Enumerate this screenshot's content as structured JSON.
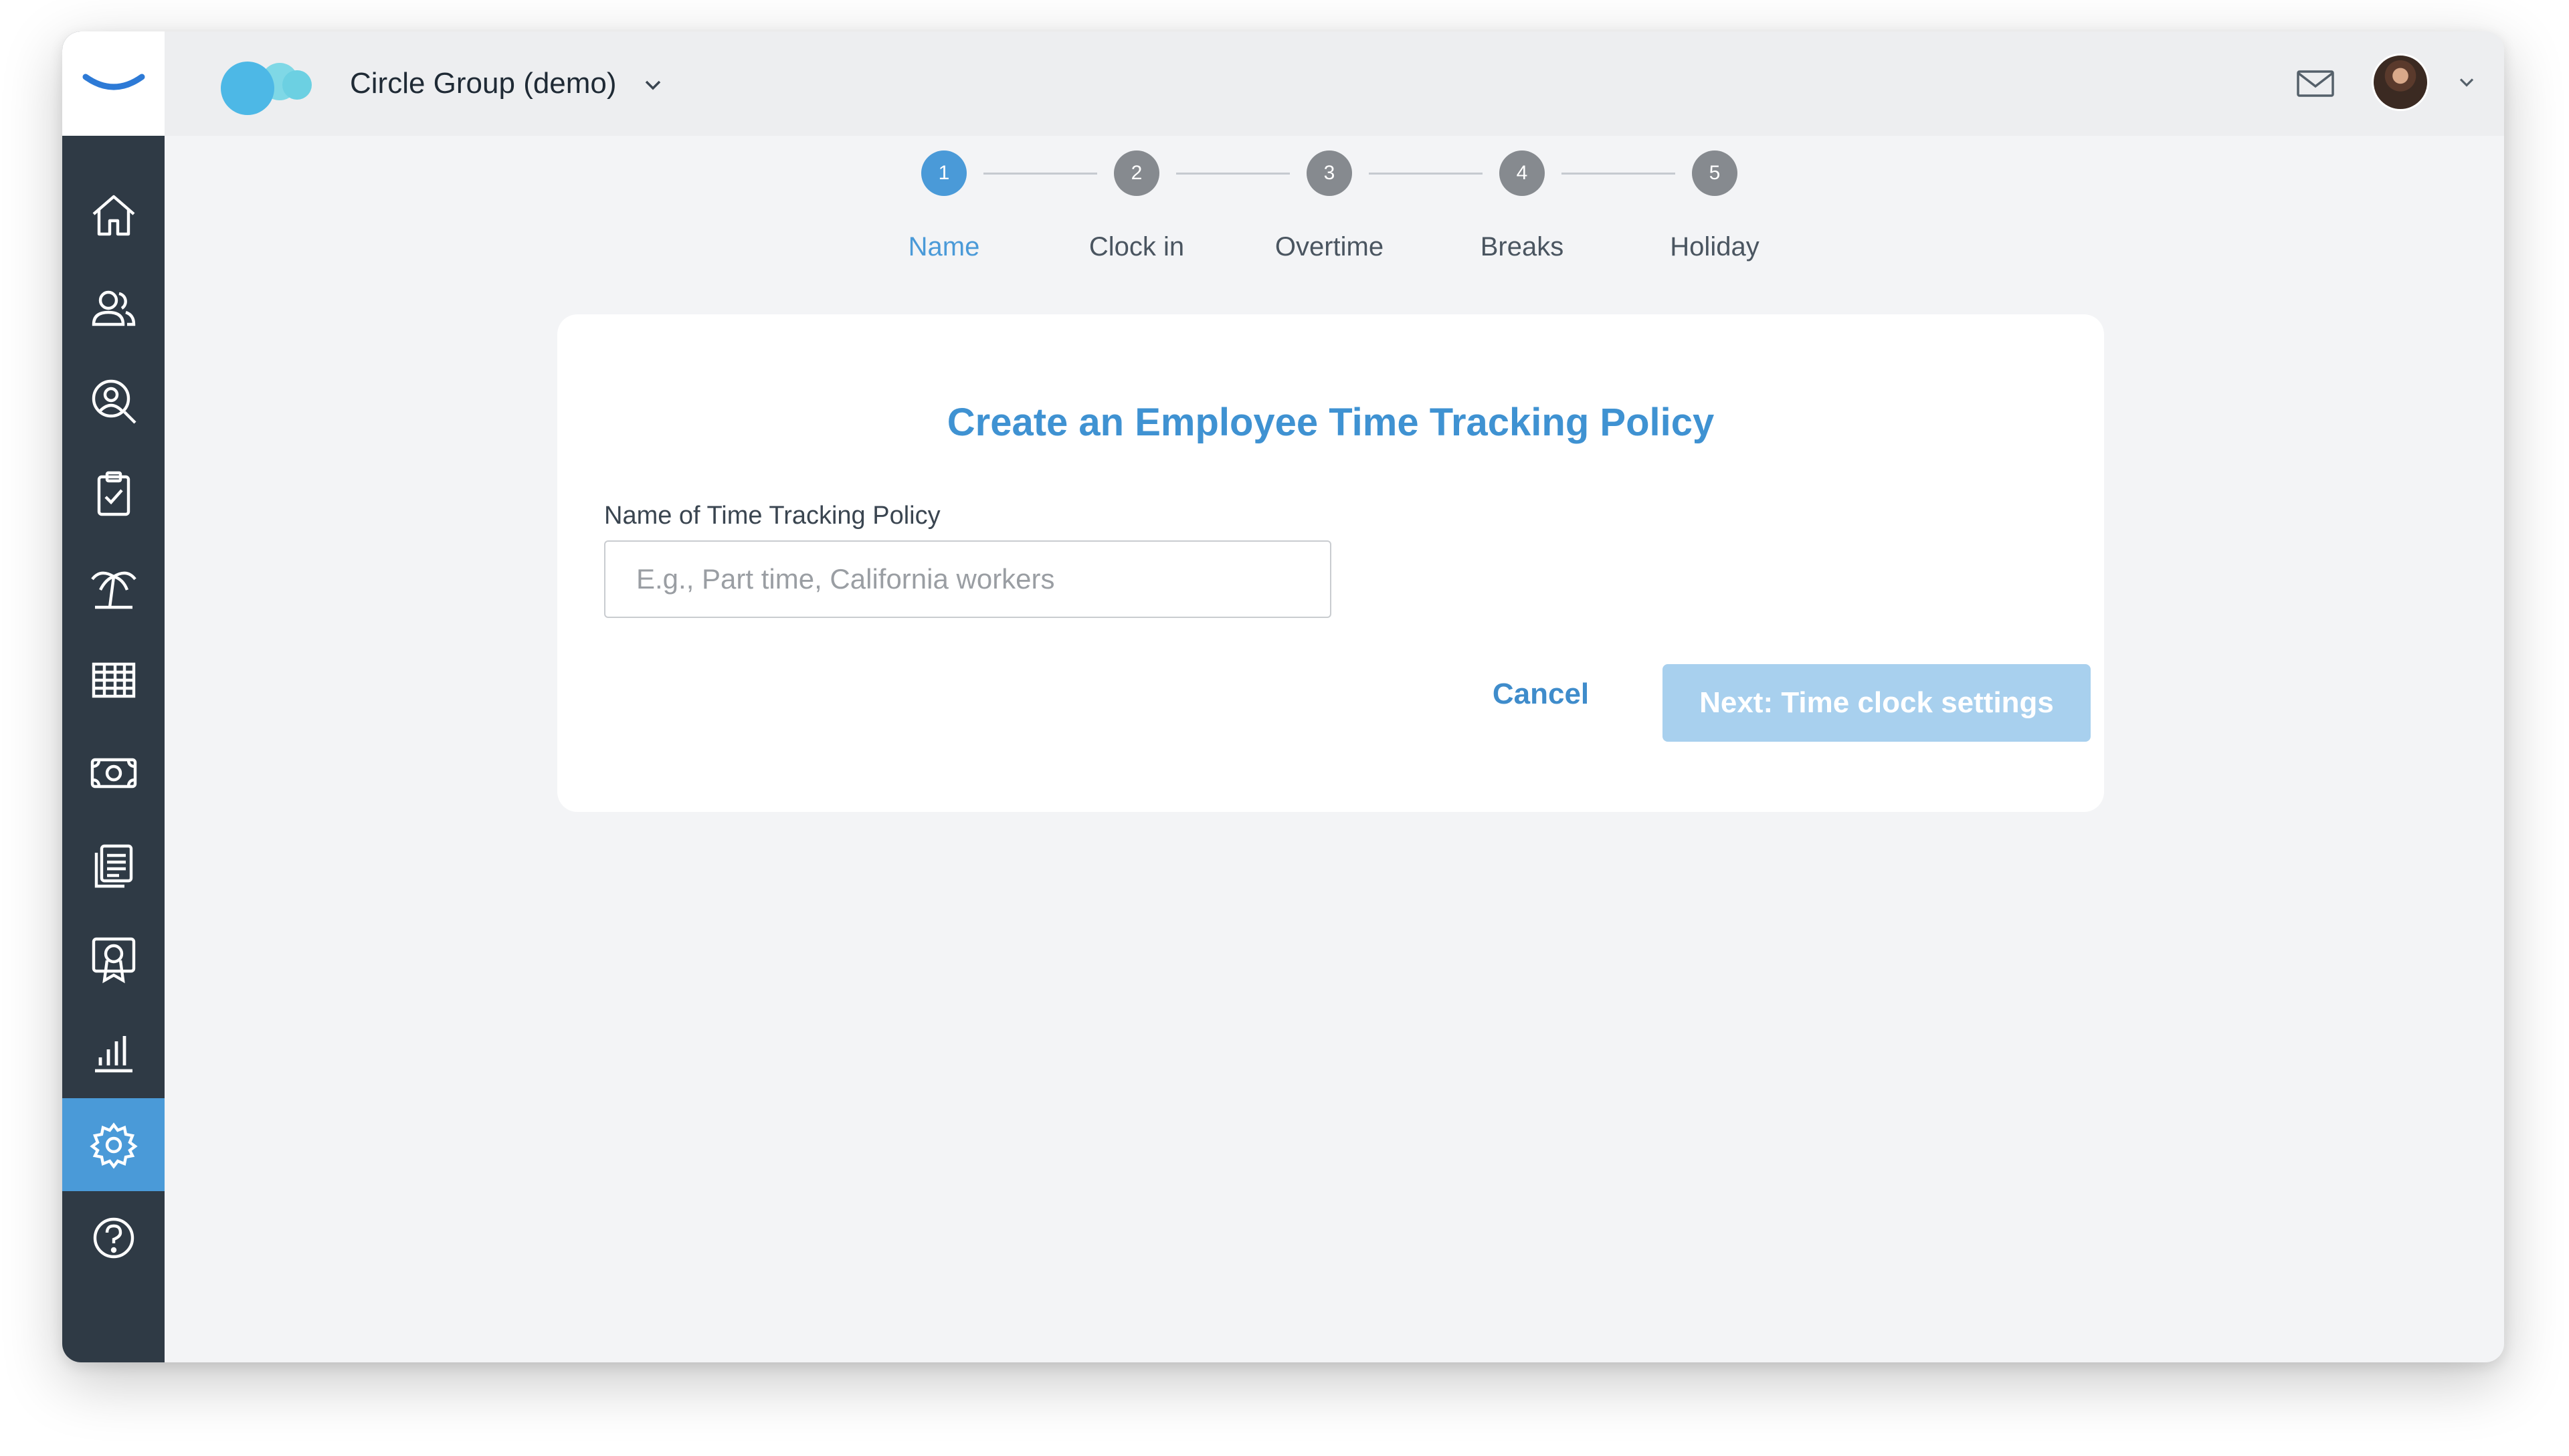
{
  "header": {
    "org_name": "Circle Group (demo)",
    "icons": [
      "org-logo-icon",
      "chevron-down-icon",
      "mail-icon",
      "avatar",
      "chevron-down-icon"
    ]
  },
  "sidebar": {
    "items": [
      {
        "name": "home",
        "icon": "home-icon"
      },
      {
        "name": "people",
        "icon": "people-icon"
      },
      {
        "name": "directory",
        "icon": "person-search-icon"
      },
      {
        "name": "tasks",
        "icon": "clipboard-check-icon"
      },
      {
        "name": "time-off",
        "icon": "palm-tree-icon"
      },
      {
        "name": "schedule",
        "icon": "table-grid-icon"
      },
      {
        "name": "payroll",
        "icon": "money-icon"
      },
      {
        "name": "documents",
        "icon": "documents-icon"
      },
      {
        "name": "training",
        "icon": "certificate-icon"
      },
      {
        "name": "reports",
        "icon": "bar-chart-icon"
      },
      {
        "name": "settings",
        "icon": "gear-icon",
        "active": true
      },
      {
        "name": "help",
        "icon": "help-icon"
      }
    ]
  },
  "stepper": {
    "steps": [
      {
        "number": "1",
        "label": "Name",
        "active": true
      },
      {
        "number": "2",
        "label": "Clock in"
      },
      {
        "number": "3",
        "label": "Overtime"
      },
      {
        "number": "4",
        "label": "Breaks"
      },
      {
        "number": "5",
        "label": "Holiday"
      }
    ]
  },
  "form": {
    "title": "Create an Employee Time Tracking Policy",
    "field_label": "Name of Time Tracking Policy",
    "field_placeholder": "E.g., Part time, California workers",
    "field_value": "",
    "cancel_label": "Cancel",
    "next_label": "Next: Time clock settings"
  },
  "colors": {
    "accent": "#4a9ad8",
    "sidebar_bg": "#2f3a45",
    "next_button_disabled": "#a8d0ee",
    "step_inactive": "#868a8f"
  }
}
